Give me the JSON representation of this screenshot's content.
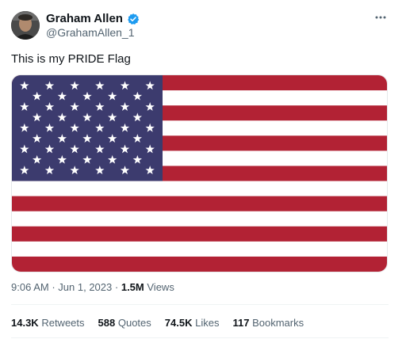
{
  "author": {
    "display_name": "Graham Allen",
    "handle": "@GrahamAllen_1",
    "verified_icon": "verified-badge-icon",
    "accent_color": "#1d9bf0"
  },
  "tweet": {
    "text": "This is my PRIDE Flag",
    "image": "us-flag-image",
    "time": "9:06 AM",
    "separator": "·",
    "date": "Jun 1, 2023",
    "views_count": "1.5M",
    "views_label": "Views"
  },
  "stats": {
    "retweets_count": "14.3K",
    "retweets_label": "Retweets",
    "quotes_count": "588",
    "quotes_label": "Quotes",
    "likes_count": "74.5K",
    "likes_label": "Likes",
    "bookmarks_count": "117",
    "bookmarks_label": "Bookmarks"
  },
  "colors": {
    "flag_red": "#b22234",
    "flag_blue": "#3c3b6e",
    "flag_white": "#ffffff",
    "secondary_text": "#536471"
  }
}
